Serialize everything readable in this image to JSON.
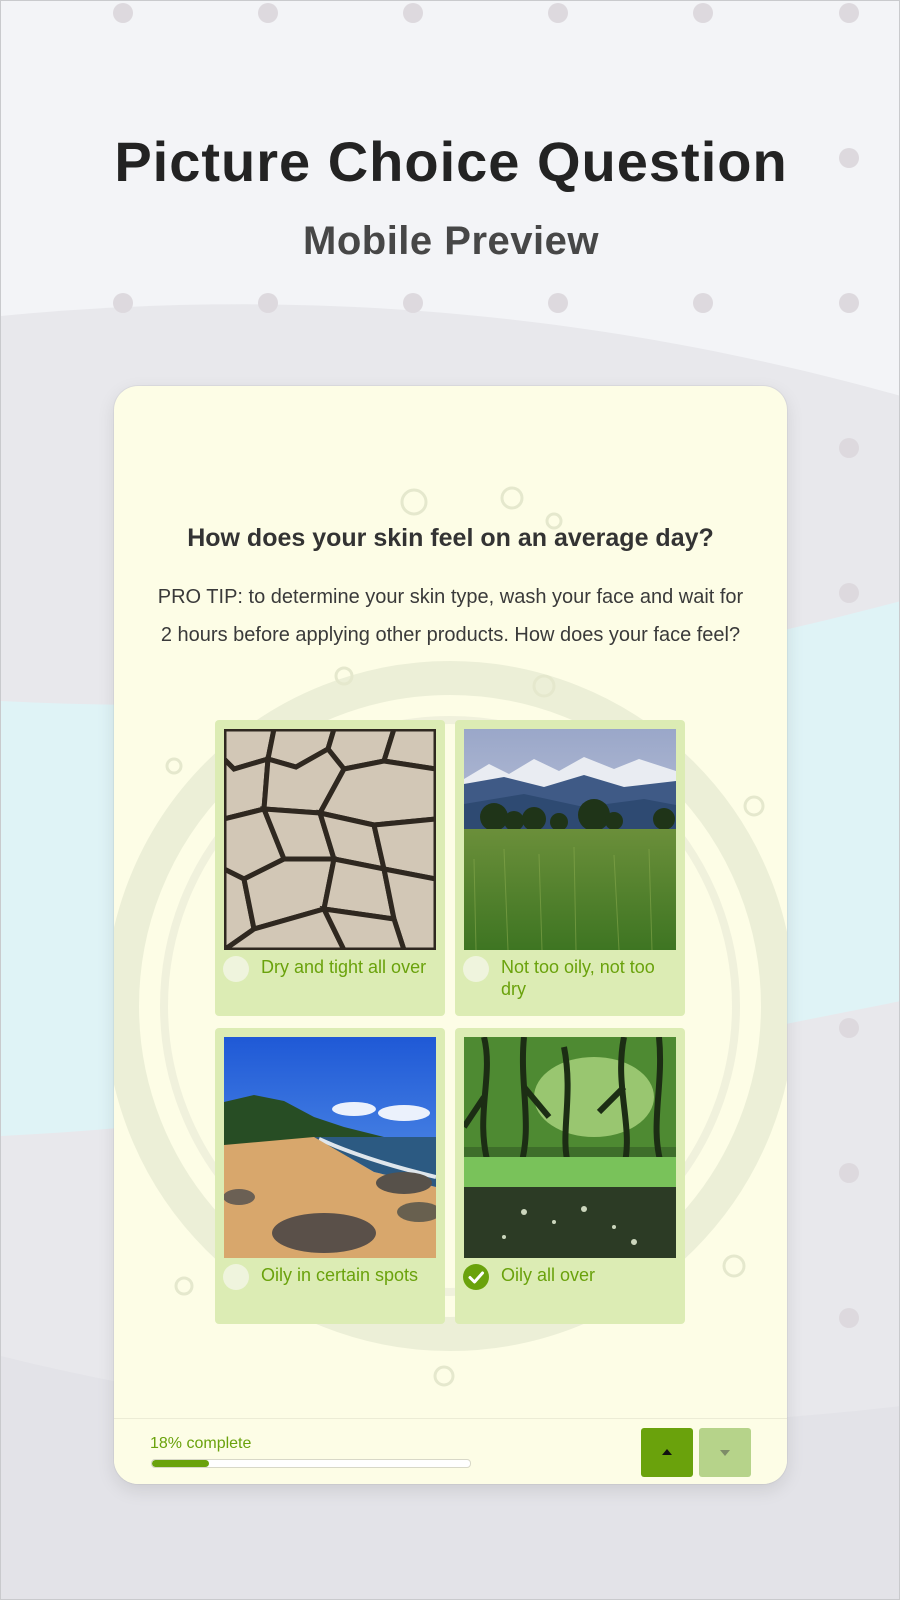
{
  "colors": {
    "accent": "#6aa20c",
    "accent_light": "#dcecb4",
    "card_bg": "#fdfde6",
    "page_bg": "#f3f4f7",
    "cyan_band": "#dff3f6",
    "dot": "#ddd9de"
  },
  "hero": {
    "title": "Picture Choice Question",
    "subtitle": "Mobile Preview"
  },
  "question": {
    "title": "How does your skin feel on an average day?",
    "description": "PRO TIP: to determine your skin type, wash your face and wait for 2 hours before applying other products. How does your face feel?"
  },
  "options": [
    {
      "label": "Dry and tight all over",
      "image": "cracked-earth-image",
      "selected": false
    },
    {
      "label": "Not too oily, not too dry",
      "image": "mountain-meadow-image",
      "selected": false
    },
    {
      "label": "Oily in certain spots",
      "image": "beach-image",
      "selected": false
    },
    {
      "label": "Oily all over",
      "image": "mangrove-swamp-image",
      "selected": true
    }
  ],
  "progress": {
    "label": "18% complete",
    "percent": 18
  },
  "navigation": {
    "up_icon": "caret-up-icon",
    "down_icon": "caret-down-icon"
  }
}
